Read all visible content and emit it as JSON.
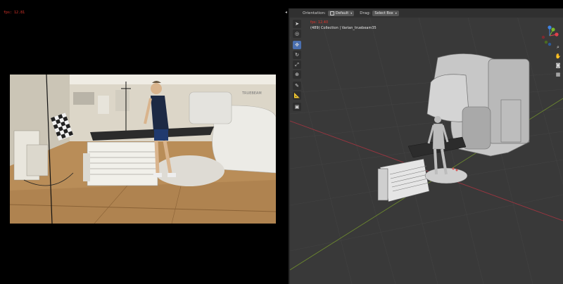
{
  "left_panel": {
    "fps": "fps: 12.81"
  },
  "viewport": {
    "header": {
      "orientation_label": "Orientation:",
      "orientation_value": "Default",
      "drag_label": "Drag:",
      "drag_value": "Select Box"
    },
    "info": {
      "fps": "fps: 12.40",
      "collection": "(489) Collection | Varian_truebeam35"
    },
    "tools": [
      "cursor-tool",
      "cursor-3d-tool",
      "move-tool",
      "rotate-tool",
      "scale-tool",
      "transform-tool",
      "annotate-tool",
      "measure-tool",
      "add-cube-tool"
    ],
    "active_tool": "move-tool",
    "gizmo": {
      "x_color": "#e0414b",
      "y_color": "#7ab62c",
      "z_color": "#3f83e2"
    },
    "nav_buttons": [
      "zoom-icon",
      "hand-pan-icon",
      "camera-icon",
      "grid-icon"
    ]
  },
  "colors": {
    "background": "#000000",
    "viewport_bg": "#393939",
    "header_bg": "#303030",
    "active_tool": "#4a6fb0",
    "fps_red": "#e0352b"
  }
}
